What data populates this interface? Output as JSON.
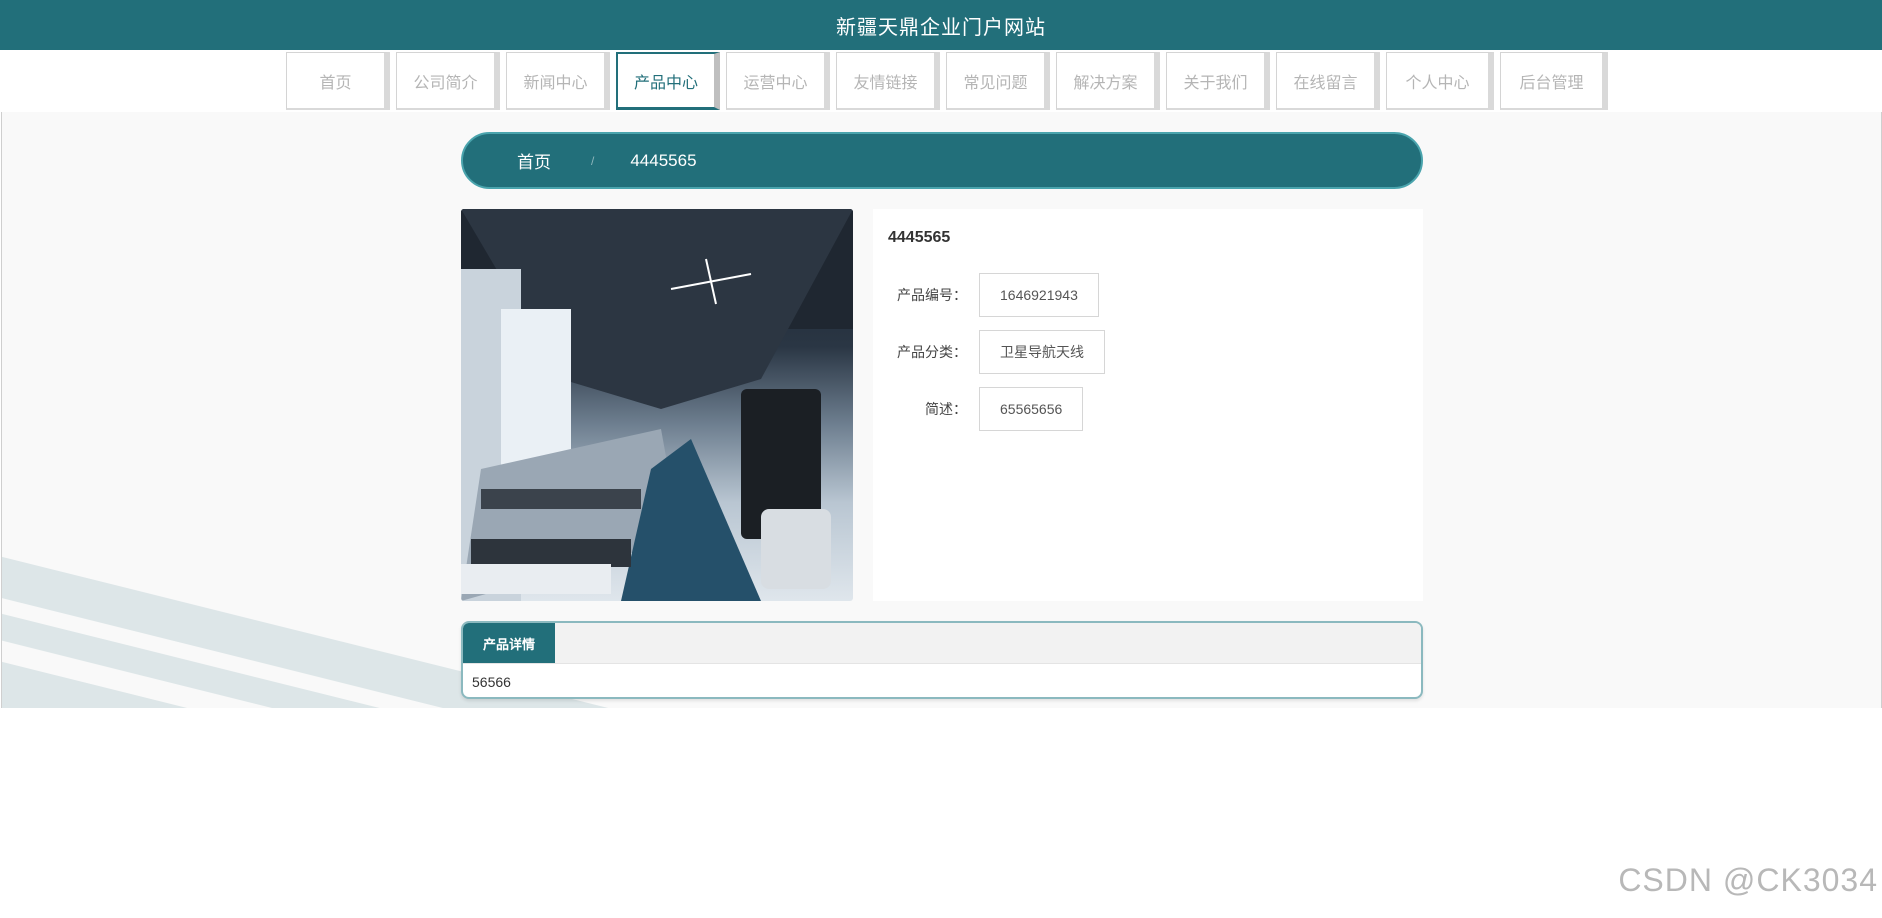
{
  "site": {
    "title": "新疆天鼎企业门户网站"
  },
  "nav": {
    "items": [
      {
        "label": "首页"
      },
      {
        "label": "公司简介"
      },
      {
        "label": "新闻中心"
      },
      {
        "label": "产品中心"
      },
      {
        "label": "运营中心"
      },
      {
        "label": "友情链接"
      },
      {
        "label": "常见问题"
      },
      {
        "label": "解决方案"
      },
      {
        "label": "关于我们"
      },
      {
        "label": "在线留言"
      },
      {
        "label": "个人中心"
      },
      {
        "label": "后台管理"
      }
    ],
    "active_index": 3
  },
  "breadcrumb": {
    "home": "首页",
    "separator": "/",
    "current": "4445565"
  },
  "product": {
    "name": "4445565",
    "fields": [
      {
        "label": "产品编号：",
        "value": "1646921943"
      },
      {
        "label": "产品分类：",
        "value": "卫星导航天线"
      },
      {
        "label": "简述：",
        "value": "65565656"
      }
    ],
    "image_icon": "gym-interior-photo"
  },
  "detail": {
    "tab_label": "产品详情",
    "content": "56566"
  },
  "watermark": "CSDN @CK3034",
  "colors": {
    "primary": "#226f7a",
    "accent_border": "#4aa4ad"
  }
}
